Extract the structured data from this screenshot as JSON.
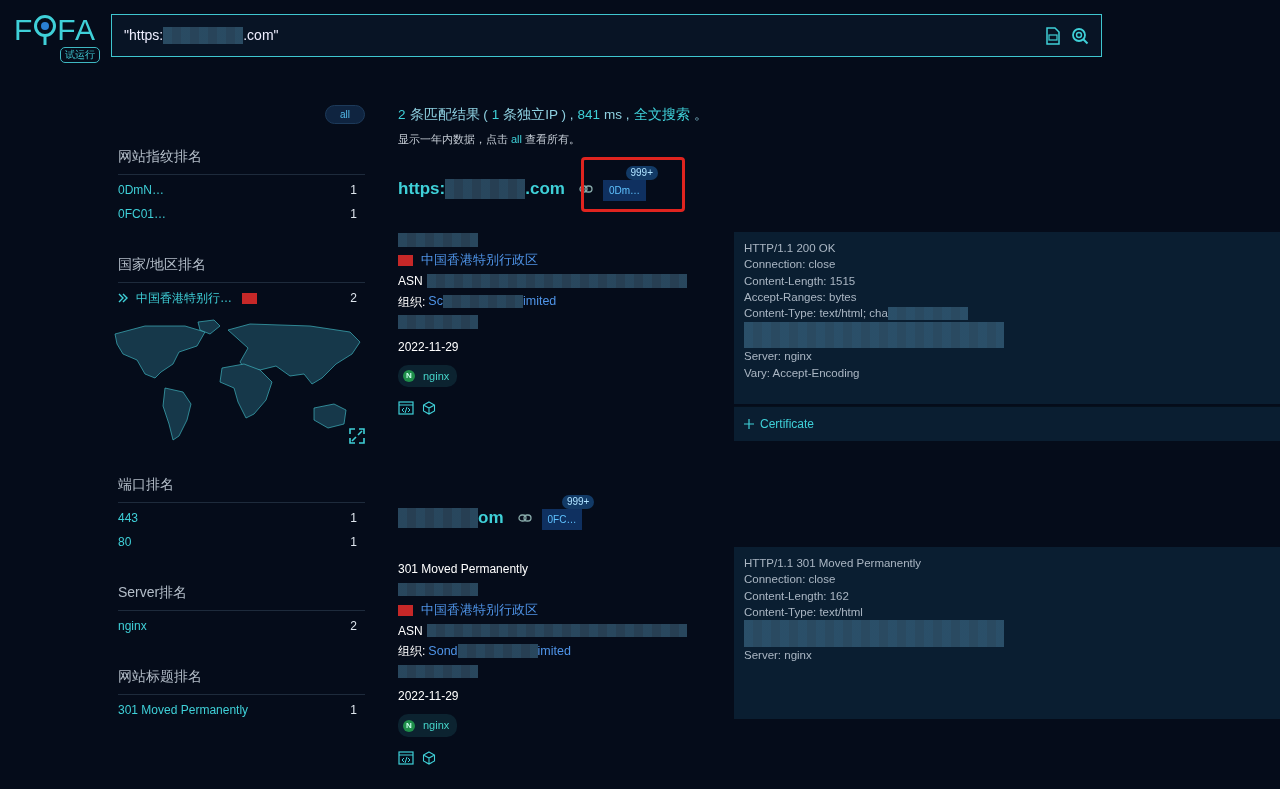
{
  "logo": {
    "left": "F",
    "right": "FA",
    "badge": "试运行"
  },
  "search": {
    "value": [
      {
        "kind": "text",
        "text": "\"https:"
      },
      {
        "kind": "redacted"
      },
      {
        "kind": "text",
        "text": ".com\""
      }
    ]
  },
  "sidebar": {
    "all_button": "all",
    "sections": [
      {
        "title": "网站指纹排名",
        "kind": "list",
        "items": [
          {
            "label": "0DmN…",
            "count": "1"
          },
          {
            "label": "0FC01…",
            "count": "1"
          }
        ]
      },
      {
        "title": "国家/地区排名",
        "kind": "map",
        "items": [
          {
            "label": "中国香港特别行…",
            "count": "2",
            "flag": true
          }
        ]
      },
      {
        "title": "端口排名",
        "kind": "list",
        "items": [
          {
            "label": "443",
            "count": "1"
          },
          {
            "label": "80",
            "count": "1"
          }
        ]
      },
      {
        "title": "Server排名",
        "kind": "list",
        "items": [
          {
            "label": "nginx",
            "count": "2"
          }
        ]
      },
      {
        "title": "网站标题排名",
        "kind": "list",
        "items": [
          {
            "label": "301 Moved Permanently",
            "count": "1"
          }
        ]
      }
    ]
  },
  "summary": [
    {
      "kind": "accent",
      "text": "2"
    },
    {
      "kind": "text",
      "text": "条匹配结果 ("
    },
    {
      "kind": "accent",
      "text": "1"
    },
    {
      "kind": "text",
      "text": "条独立IP ) ,"
    },
    {
      "kind": "accent",
      "text": "841"
    },
    {
      "kind": "text",
      "text": "ms ,"
    },
    {
      "kind": "link",
      "text": "全文搜索"
    },
    {
      "kind": "text",
      "text": "。"
    }
  ],
  "note": [
    {
      "kind": "text",
      "text": "显示一年内数据，点击"
    },
    {
      "kind": "link",
      "text": "all"
    },
    {
      "kind": "text",
      "text": "查看所有。"
    }
  ],
  "results": [
    {
      "host": [
        {
          "kind": "text",
          "text": "https:"
        },
        {
          "kind": "redacted"
        },
        {
          "kind": "text",
          "text": ".com"
        }
      ],
      "tag": {
        "label": "0Dm…",
        "count": "999+",
        "highlighted": true
      },
      "info": [
        {
          "kind": "redacted"
        },
        {
          "kind": "location",
          "text": "中国香港特别行政区"
        },
        {
          "kind": "asn",
          "label": "ASN",
          "parts": [
            {
              "kind": "redacted"
            }
          ]
        },
        {
          "kind": "org",
          "label": "组织:",
          "parts": [
            {
              "kind": "link",
              "text": "Sc"
            },
            {
              "kind": "redacted"
            },
            {
              "kind": "link",
              "text": "imited"
            }
          ]
        },
        {
          "kind": "redacted"
        },
        {
          "kind": "date",
          "text": "2022-11-29"
        }
      ],
      "server": {
        "icon_letter": "N",
        "label": "nginx"
      },
      "headers": [
        [
          {
            "kind": "text",
            "text": "HTTP/1.1 200 OK"
          }
        ],
        [
          {
            "kind": "text",
            "text": "Connection: close"
          }
        ],
        [
          {
            "kind": "text",
            "text": "Content-Length: 1515"
          }
        ],
        [
          {
            "kind": "text",
            "text": "Accept-Ranges: bytes"
          }
        ],
        [
          {
            "kind": "text",
            "text": "Content-Type: text/html; cha"
          },
          {
            "kind": "redacted"
          }
        ],
        [
          {
            "kind": "redacted"
          }
        ],
        [
          {
            "kind": "redacted"
          }
        ],
        [
          {
            "kind": "text",
            "text": "Server: nginx"
          }
        ],
        [
          {
            "kind": "text",
            "text": "Vary: Accept-Encoding"
          }
        ]
      ],
      "certificate": "Certificate"
    },
    {
      "host": [
        {
          "kind": "redacted"
        },
        {
          "kind": "text",
          "text": "om"
        }
      ],
      "tag": {
        "label": "0FC…",
        "count": "999+",
        "highlighted": false
      },
      "info": [
        {
          "kind": "title",
          "text": "301 Moved Permanently"
        },
        {
          "kind": "redacted"
        },
        {
          "kind": "location",
          "text": "中国香港特别行政区"
        },
        {
          "kind": "asn",
          "label": "ASN",
          "parts": [
            {
              "kind": "redacted"
            }
          ]
        },
        {
          "kind": "org",
          "label": "组织:",
          "parts": [
            {
              "kind": "link",
              "text": "Sond"
            },
            {
              "kind": "redacted"
            },
            {
              "kind": "link",
              "text": "imited"
            }
          ]
        },
        {
          "kind": "redacted"
        },
        {
          "kind": "date",
          "text": "2022-11-29"
        }
      ],
      "server": {
        "icon_letter": "N",
        "label": "nginx"
      },
      "headers": [
        [
          {
            "kind": "text",
            "text": "HTTP/1.1 301 Moved Permanently"
          }
        ],
        [
          {
            "kind": "text",
            "text": "Connection: close"
          }
        ],
        [
          {
            "kind": "text",
            "text": "Content-Length: 162"
          }
        ],
        [
          {
            "kind": "text",
            "text": "Content-Type: text/html"
          }
        ],
        [
          {
            "kind": "redacted"
          }
        ],
        [
          {
            "kind": "redacted"
          }
        ],
        [
          {
            "kind": "text",
            "text": "Server: nginx"
          }
        ]
      ]
    }
  ]
}
